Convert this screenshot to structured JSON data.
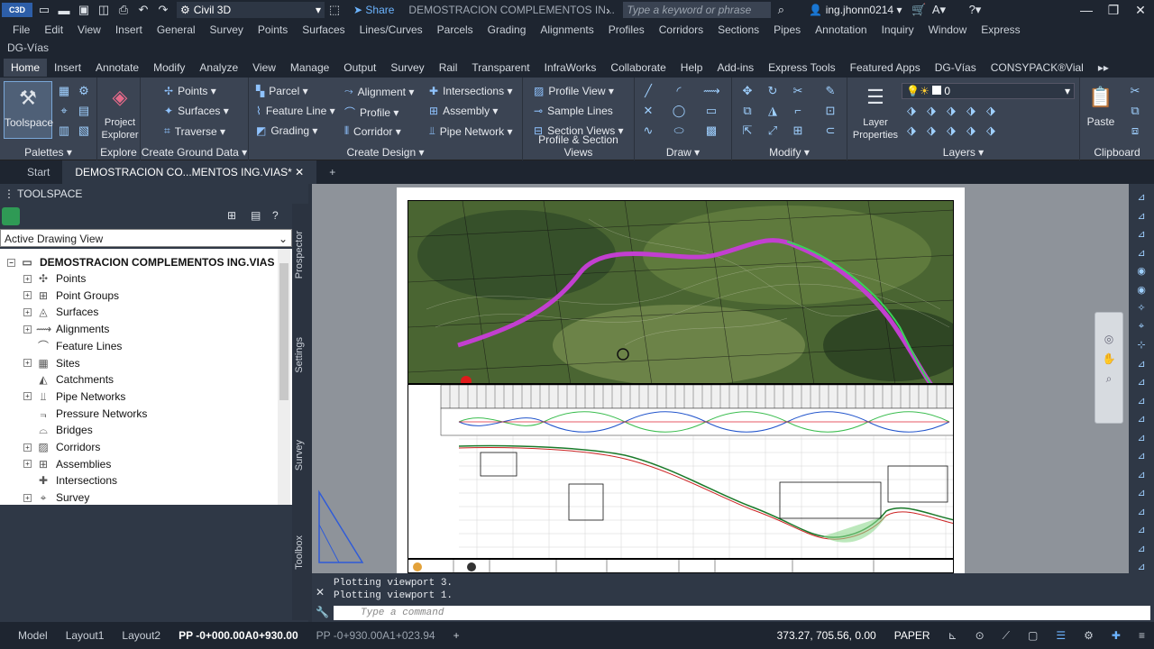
{
  "app": {
    "logo": "C3D",
    "workspace": "Civil 3D",
    "share": "Share",
    "doc_title": "DEMOSTRACION COMPLEMENTOS IN...",
    "search_placeholder": "Type a keyword or phrase",
    "user": "ing.jhonn0214"
  },
  "menu": [
    "File",
    "Edit",
    "View",
    "Insert",
    "General",
    "Survey",
    "Points",
    "Surfaces",
    "Lines/Curves",
    "Parcels",
    "Grading",
    "Alignments",
    "Profiles",
    "Corridors",
    "Sections",
    "Pipes",
    "Annotation",
    "Inquiry",
    "Window",
    "Express"
  ],
  "menu2": "DG-Vías",
  "ribbon_tabs": [
    "Home",
    "Insert",
    "Annotate",
    "Modify",
    "Analyze",
    "View",
    "Manage",
    "Output",
    "Survey",
    "Rail",
    "Transparent",
    "InfraWorks",
    "Collaborate",
    "Help",
    "Add-ins",
    "Express Tools",
    "Featured Apps",
    "DG-Vías",
    "CONSYPACK®Vial"
  ],
  "ribbon": {
    "palettes": {
      "title": "Palettes",
      "toolspace": "Toolspace"
    },
    "explore": {
      "title": "Explore",
      "project_explorer": "Project Explorer"
    },
    "ground": {
      "title": "Create Ground Data",
      "points": "Points",
      "surfaces": "Surfaces",
      "traverse": "Traverse"
    },
    "design": {
      "title": "Create Design",
      "parcel": "Parcel",
      "feature_line": "Feature Line",
      "grading": "Grading",
      "alignment": "Alignment",
      "profile": "Profile",
      "corridor": "Corridor",
      "intersections": "Intersections",
      "assembly": "Assembly",
      "pipe_network": "Pipe Network"
    },
    "psv": {
      "title": "Profile & Section Views",
      "profile_view": "Profile View",
      "sample_lines": "Sample Lines",
      "section_views": "Section Views"
    },
    "draw": {
      "title": "Draw"
    },
    "modify": {
      "title": "Modify"
    },
    "layers": {
      "title": "Layers",
      "layer_properties": "Layer Properties",
      "current_layer": "0"
    },
    "clipboard": {
      "title": "Clipboard",
      "paste": "Paste"
    }
  },
  "doc_tabs": {
    "start": "Start",
    "active": "DEMOSTRACION CO...MENTOS ING.VIAS*"
  },
  "toolspace": {
    "title": "TOOLSPACE",
    "view": "Active Drawing View",
    "root": "DEMOSTRACION COMPLEMENTOS ING.VIAS",
    "items": [
      "Points",
      "Point Groups",
      "Surfaces",
      "Alignments",
      "Feature Lines",
      "Sites",
      "Catchments",
      "Pipe Networks",
      "Pressure Networks",
      "Bridges",
      "Corridors",
      "Assemblies",
      "Intersections",
      "Survey"
    ],
    "vtabs": [
      "Prospector",
      "Settings",
      "Survey",
      "Toolbox"
    ]
  },
  "command": {
    "history": [
      "Plotting viewport 3.",
      "Plotting viewport 1."
    ],
    "placeholder": "Type a command"
  },
  "status": {
    "model": "Model",
    "layout1": "Layout1",
    "layout2": "Layout2",
    "layout3": "PP -0+000.00A0+930.00",
    "layout4": "PP -0+930.00A1+023.94",
    "coords": "373.27, 705.56, 0.00",
    "paper": "PAPER"
  }
}
